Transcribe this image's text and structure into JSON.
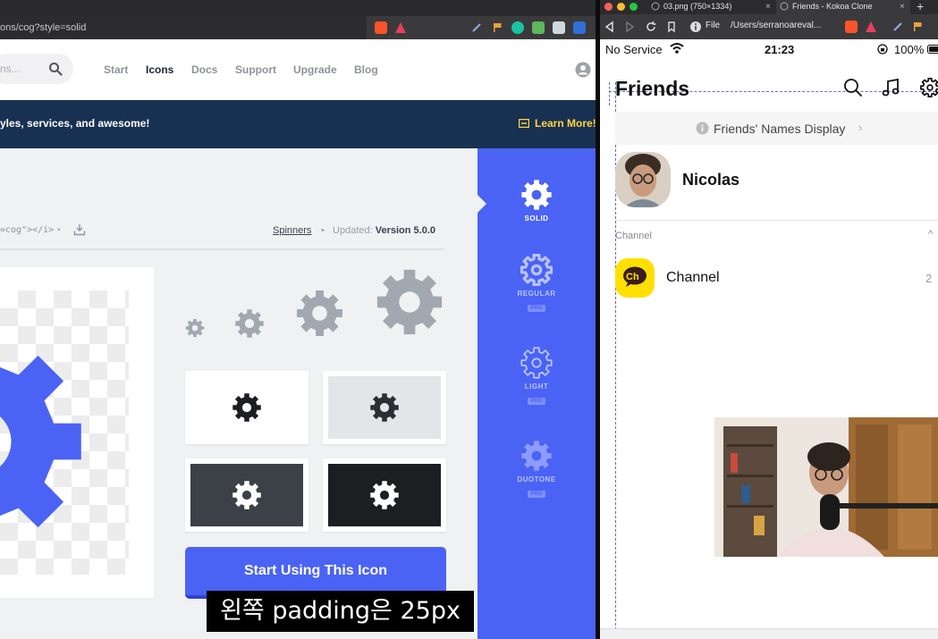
{
  "left_browser": {
    "url": "ons/cog?style=solid",
    "nav": {
      "search_placeholder": "ns...",
      "links": [
        "Start",
        "Icons",
        "Docs",
        "Support",
        "Upgrade",
        "Blog"
      ],
      "active_link": "Icons"
    },
    "banner": {
      "text": "yles, services, and awesome!",
      "cta": "Learn More!"
    },
    "detail": {
      "code_snippet": "=cog\"></i>",
      "separator": "•",
      "category_link": "Spinners",
      "updated_label": "Updated:",
      "updated_value": "Version 5.0.0"
    },
    "start_button": "Start Using This Icon",
    "styles": [
      {
        "label": "SOLID",
        "pro": false
      },
      {
        "label": "REGULAR",
        "pro": true
      },
      {
        "label": "LIGHT",
        "pro": true
      },
      {
        "label": "DUOTONE",
        "pro": true
      }
    ],
    "pro_badge": "PRO"
  },
  "caption": "왼쪽 padding은 25px",
  "right_browser": {
    "tabs": [
      {
        "title": "03.png (750×1334)"
      },
      {
        "title": "Friends - Kokoa Clone"
      }
    ],
    "file_chip": "File",
    "url": "/Users/serranoareval...",
    "status": {
      "carrier": "No Service",
      "time": "21:23",
      "battery": "100%"
    },
    "app": {
      "title": "Friends",
      "names_display": "Friends' Names Display",
      "profile_name": "Nicolas",
      "channel_header": "Channel",
      "channel_arrow": "^",
      "channel_name": "Channel",
      "channel_logo_text": "Ch",
      "channel_count": "2"
    }
  },
  "colors": {
    "fa_blue": "#4a63f5",
    "fa_navy": "#183153",
    "fa_yellow": "#ffd43b",
    "kakao_yellow": "#ffe000"
  }
}
